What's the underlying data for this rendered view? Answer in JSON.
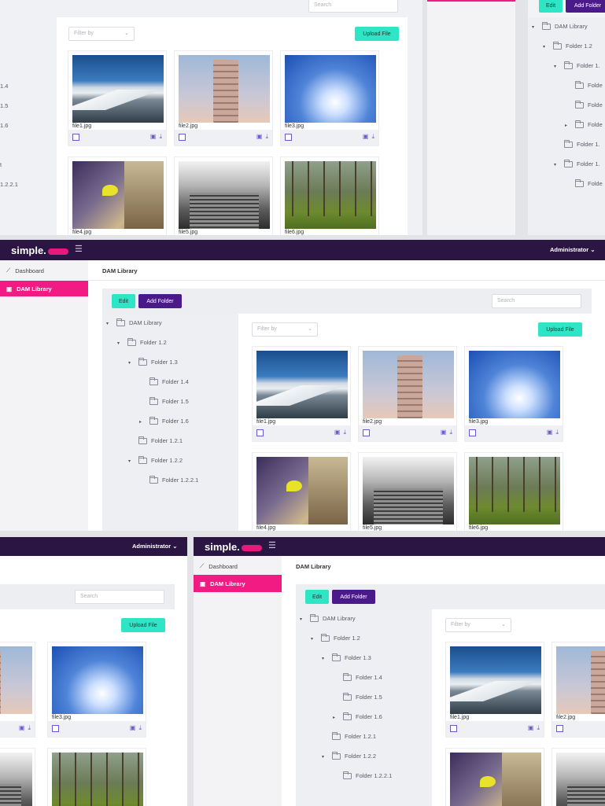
{
  "app": {
    "logo_text": "simple.",
    "user_menu": "Administrator"
  },
  "sidebar": {
    "items": [
      {
        "label": "Dashboard"
      },
      {
        "label": "DAM Library"
      }
    ]
  },
  "page": {
    "breadcrumb": "DAM Library"
  },
  "toolbar": {
    "edit_label": "Edit",
    "add_folder_label": "Add Folder",
    "search_placeholder": "Search",
    "filter_placeholder": "Filter by",
    "upload_label": "Upload File"
  },
  "tree": {
    "nodes": [
      {
        "label": "DAM Library"
      },
      {
        "label": "Folder 1.2"
      },
      {
        "label": "Folder 1.3"
      },
      {
        "label": "Folder 1.4"
      },
      {
        "label": "Folder 1.5"
      },
      {
        "label": "Folder 1.6"
      },
      {
        "label": "Folder 1.2.1"
      },
      {
        "label": "Folder 1.2.2"
      },
      {
        "label": "Folder 1.2.2.1"
      }
    ]
  },
  "files": [
    {
      "name": "file1.jpg"
    },
    {
      "name": "file2.jpg"
    },
    {
      "name": "file3.jpg"
    },
    {
      "name": "file4.jpg"
    },
    {
      "name": "file5.jpg"
    },
    {
      "name": "file6.jpg"
    }
  ],
  "fragments": {
    "top_left_tree_labels": [
      "1.4",
      "1.5",
      "1.6",
      "",
      "t",
      "1.2.2.1"
    ],
    "top_right_tree_labels": [
      "DAM Library",
      "Folder 1.2",
      "Folder 1.",
      "Folde",
      "Folde",
      "Folde",
      "Folder 1.",
      "Folder 1.",
      "Folde"
    ]
  },
  "colors": {
    "topbar": "#2a1543",
    "accent_pink": "#f21a83",
    "accent_teal": "#2ee6c5",
    "accent_purple": "#4b1a8a"
  }
}
